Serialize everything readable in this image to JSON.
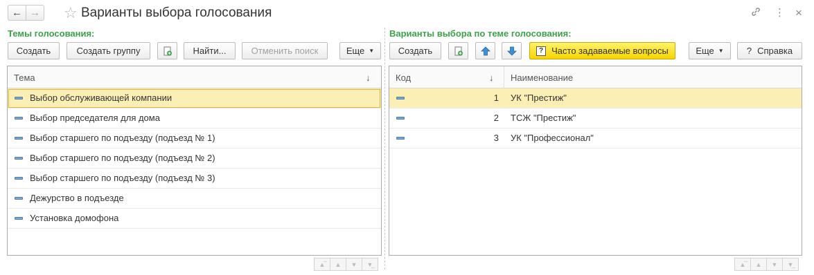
{
  "window": {
    "title": "Варианты выбора голосования"
  },
  "left": {
    "label": "Темы голосования:",
    "buttons": {
      "create": "Создать",
      "create_group": "Создать группу",
      "find": "Найти...",
      "cancel_search": "Отменить поиск",
      "more": "Еще"
    },
    "columns": {
      "theme": "Тема",
      "sort": "↓"
    },
    "rows": [
      "Выбор обслуживающей компании",
      "Выбор председателя для дома",
      "Выбор старшего по подъезду (подъезд № 1)",
      "Выбор старшего по подъезду (подъезд № 2)",
      "Выбор старшего по подъезду (подъезд № 3)",
      "Дежурство в подъезде",
      "Установка домофона"
    ]
  },
  "right": {
    "label": "Варианты выбора по теме голосования:",
    "buttons": {
      "create": "Создать",
      "faq": "Часто задаваемые вопросы",
      "more": "Еще",
      "help": "Справка"
    },
    "columns": {
      "code": "Код",
      "sort": "↓",
      "name": "Наименование"
    },
    "rows": [
      {
        "code": "1",
        "name": "УК \"Престиж\""
      },
      {
        "code": "2",
        "name": "ТСЖ \"Престиж\""
      },
      {
        "code": "3",
        "name": "УК \"Профессионал\""
      }
    ]
  },
  "icons": [
    "back-arrow-icon",
    "forward-arrow-icon",
    "favorite-star-icon",
    "link-icon",
    "more-vertical-icon",
    "close-icon",
    "copy-icon",
    "move-up-icon",
    "move-down-icon",
    "question-icon",
    "pager-first-icon",
    "pager-up-icon",
    "pager-down-icon",
    "pager-last-icon"
  ]
}
